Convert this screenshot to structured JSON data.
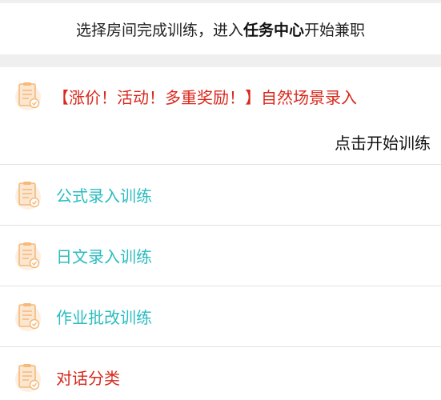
{
  "header": {
    "prefix": "选择房间完成训练，进入",
    "highlight": "任务中心",
    "suffix": "开始兼职"
  },
  "promo": {
    "title": "【涨价！活动！多重奖励！】自然场景录入",
    "start_label": "点击开始训练",
    "icon": "clipboard-check-icon",
    "title_color": "#d8281c"
  },
  "items": [
    {
      "label": "公式录入训练",
      "color": "#2bbcc0",
      "icon": "clipboard-check-icon"
    },
    {
      "label": "日文录入训练",
      "color": "#2bbcc0",
      "icon": "clipboard-check-icon"
    },
    {
      "label": "作业批改训练",
      "color": "#2bbcc0",
      "icon": "clipboard-check-icon"
    },
    {
      "label": "对话分类",
      "color": "#d8281c",
      "icon": "clipboard-check-icon"
    }
  ],
  "colors": {
    "accent_teal": "#2bbcc0",
    "accent_red": "#d8281c",
    "icon_orange": "#f5b97a"
  }
}
